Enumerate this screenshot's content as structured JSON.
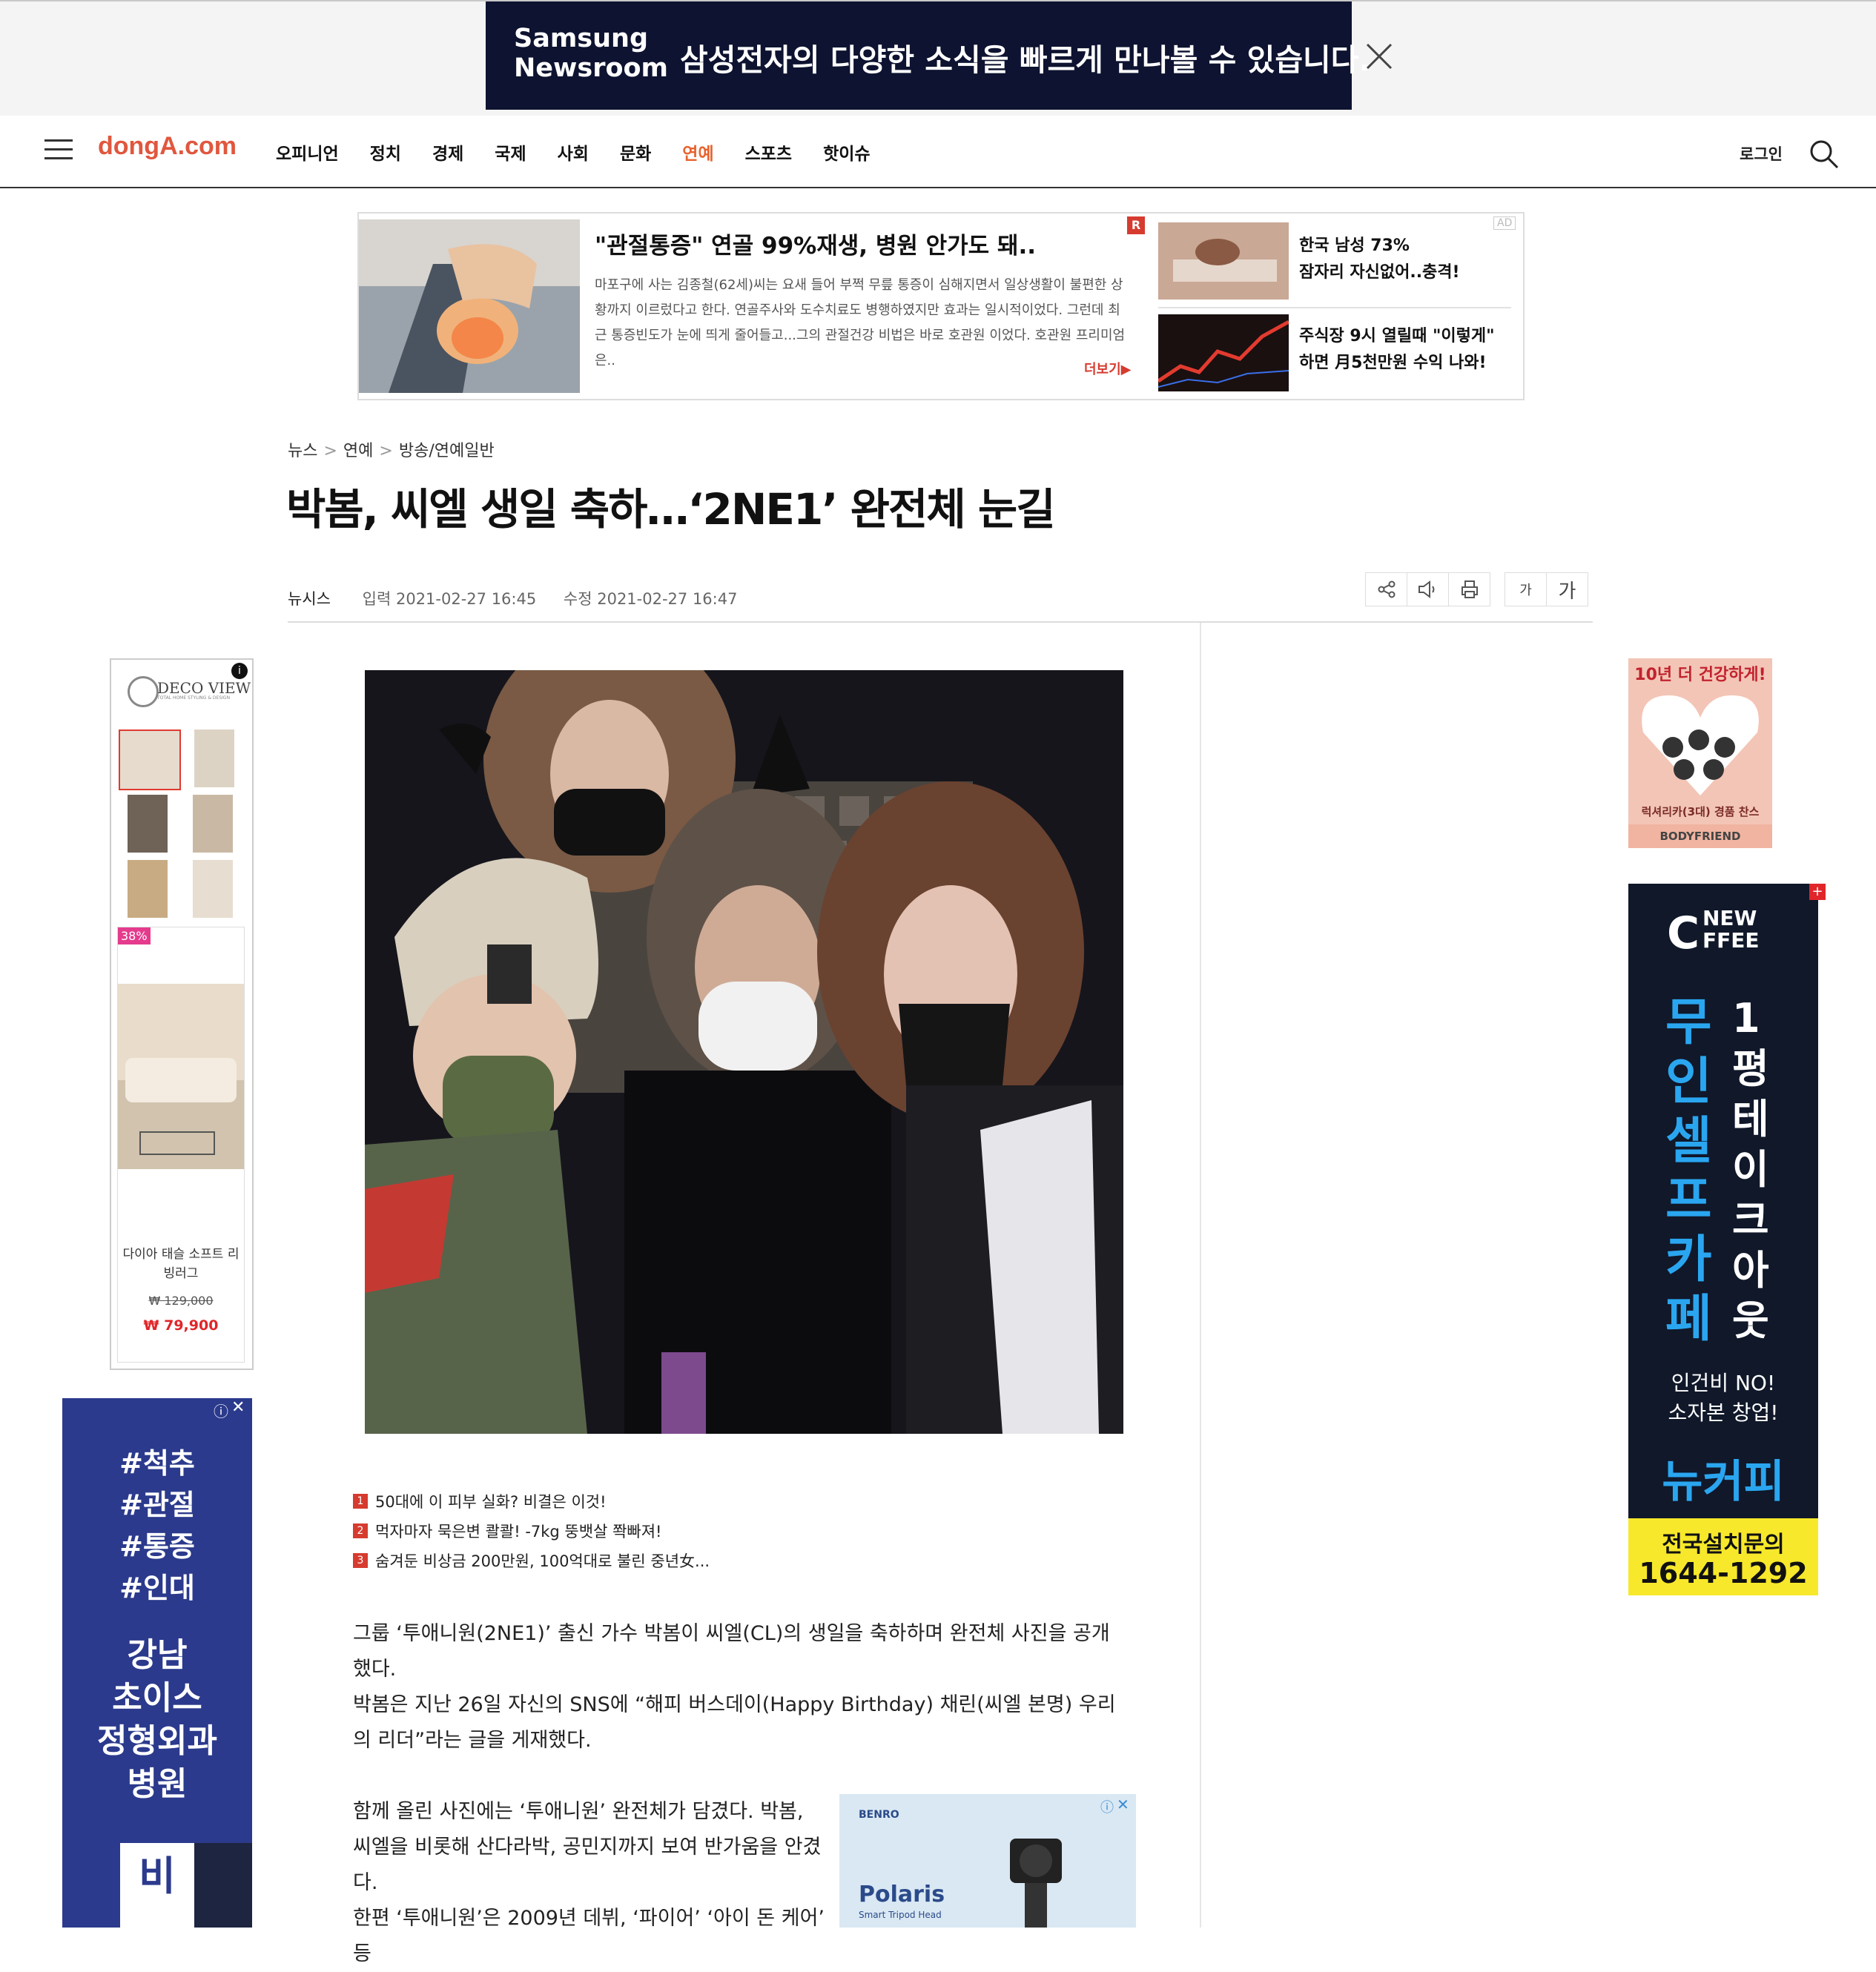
{
  "top_banner": {
    "logo_line1": "Samsung",
    "logo_line2": "Newsroom",
    "text": "삼성전자의 다양한 소식을 빠르게 만나볼 수 있습니다."
  },
  "gnb": {
    "logo": "dongA.com",
    "nav": [
      "오피니언",
      "정치",
      "경제",
      "국제",
      "사회",
      "문화",
      "연예",
      "스포츠",
      "핫이슈"
    ],
    "active": "연예",
    "login": "로그인"
  },
  "native_ad": {
    "headline": "\"관절통증\" 연골 99%재생, 병원 안가도 돼..",
    "body": "마포구에 사는 김종철(62세)씨는 요새 들어 부쩍 무릎 통증이 심해지면서 일상생활이 불편한 상황까지 이르렀다고 한다. 연골주사와 도수치료도 병행하였지만 효과는 일시적이었다. 그런데 최근 통증빈도가 눈에 띄게 줄어들고...그의 관절건강 비법은 바로 호관원 이었다. 호관원 프리미엄은..",
    "more": "더보기▶",
    "r_badge": "R",
    "ad_badge": "AD",
    "side_items": [
      {
        "line1": "한국 남성 73%",
        "line2": "잠자리 자신없어..충격!"
      },
      {
        "line1": "주식장 9시 열릴때 \"이렇게\"",
        "line2": "하면 月5천만원 수익 나와!"
      }
    ]
  },
  "article": {
    "breadcrumb": [
      "뉴스",
      "연예",
      "방송/연예일반"
    ],
    "title": "박봄, 씨엘 생일 축하…‘2NE1’ 완전체 눈길",
    "source": "뉴시스",
    "input_label": "입력 2021-02-27 16:45",
    "edit_label": "수정 2021-02-27 16:47",
    "font_small": "가",
    "font_large": "가",
    "related": [
      {
        "num": "1",
        "text": "50대에 이 피부 실화? 비결은 이것!"
      },
      {
        "num": "2",
        "text": "먹자마자 묵은변 콸콸! -7kg 뚱뱃살 쫙빠져!"
      },
      {
        "num": "3",
        "text": "숨겨둔 비상금 200만원, 100억대로 불린 중년女..."
      }
    ],
    "paragraphs": [
      "그룹 ‘투애니원(2NE1)’ 출신 가수 박봄이 씨엘(CL)의 생일을 축하하며 완전체 사진을 공개했다.",
      "박봄은 지난 26일 자신의 SNS에 “해피 버스데이(Happy Birthday) 채린(씨엘 본명) 우리의 리더”라는 글을 게재했다.",
      "함께 올린 사진에는 ‘투애니원’ 완전체가 담겼다. 박봄, 씨엘을 비롯해 산다라박, 공민지까지 보여 반가움을 안겼다.",
      "한편 ‘투애니원’은 2009년 데뷔, ‘파이어’ ‘아이 돈 케어’ 등"
    ]
  },
  "left_ads": {
    "deco_brand": "DECO VIEW",
    "deco_sub": "TOTAL HOME STYLING & DESIGN",
    "discount": "38%",
    "product": "다이아 태슬 소프트 리빙러그",
    "orig_price": "₩ 129,000",
    "sale_price": "₩ 79,900",
    "ortho_tags": [
      "#척추",
      "#관절",
      "#통증",
      "#인대"
    ],
    "ortho_name": [
      "강남",
      "초이스",
      "정형외과",
      "병원"
    ],
    "ortho_bottom": "비"
  },
  "right_ads": {
    "body_top": "10년 더 건강하게!",
    "body_mid": "럭셔리카(3대) 경품 찬스",
    "body_brand": "BODYFRIEND",
    "coffee_logo1": "NEW",
    "coffee_logo2": "FFEE",
    "coffee_col1": "무인셀프카페",
    "coffee_col2": "1평테이크아웃",
    "coffee_sub1": "인건비 NO!",
    "coffee_sub2": "소자본 창업!",
    "coffee_brand": "뉴커피",
    "coffee_call": "전국설치문의",
    "coffee_phone": "1644-1292"
  },
  "inline_ad": {
    "brand": "BENRO",
    "product": "Polaris",
    "sub": "Smart Tripod Head"
  },
  "colors": {
    "brand": "#e0573e",
    "active_nav": "#e8632e",
    "badge_red": "#d63b2f",
    "banner_bg": "#0d1330"
  }
}
